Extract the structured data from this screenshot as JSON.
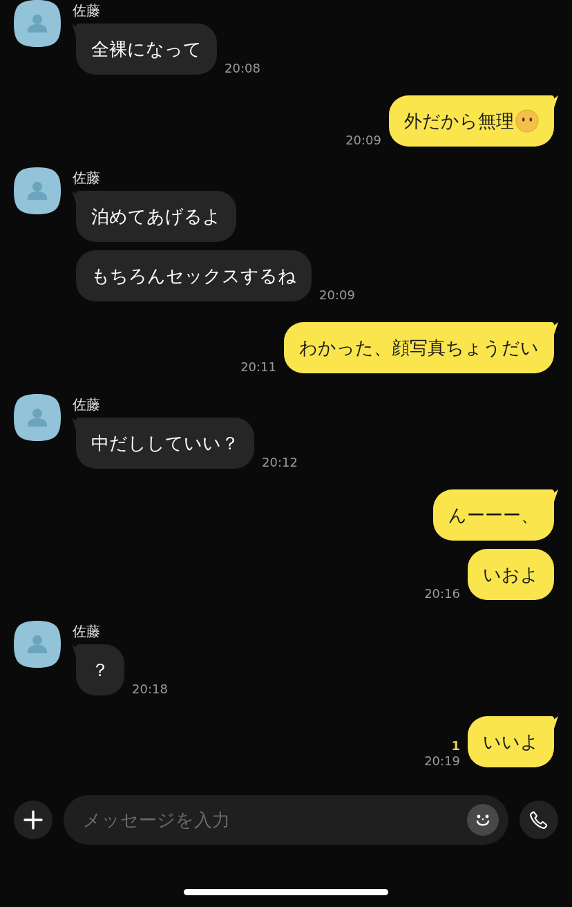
{
  "messages": [
    {
      "kind": "incoming",
      "sender": "佐藤",
      "bubbles": [
        {
          "text": "全裸になって",
          "emoji": false
        }
      ],
      "time": "20:08"
    },
    {
      "kind": "outgoing",
      "bubbles": [
        {
          "text": "外だから無理",
          "emoji": true
        }
      ],
      "time": "20:09"
    },
    {
      "kind": "incoming",
      "sender": "佐藤",
      "bubbles": [
        {
          "text": "泊めてあげるよ",
          "emoji": false
        },
        {
          "text": "もちろんセックスするね",
          "emoji": false
        }
      ],
      "time": "20:09"
    },
    {
      "kind": "outgoing",
      "bubbles": [
        {
          "text": "わかった、顔写真ちょうだい",
          "emoji": false
        }
      ],
      "time": "20:11"
    },
    {
      "kind": "incoming",
      "sender": "佐藤",
      "bubbles": [
        {
          "text": "中だししていい？",
          "emoji": false
        }
      ],
      "time": "20:12"
    },
    {
      "kind": "outgoing",
      "bubbles": [
        {
          "text": "んーーー、",
          "emoji": false
        },
        {
          "text": "いおよ",
          "emoji": false
        }
      ],
      "time": "20:16"
    },
    {
      "kind": "incoming",
      "sender": "佐藤",
      "bubbles": [
        {
          "text": "？",
          "emoji": false
        }
      ],
      "time": "20:18"
    },
    {
      "kind": "outgoing",
      "bubbles": [
        {
          "text": "いいよ",
          "emoji": false
        }
      ],
      "time": "20:19",
      "read": "1"
    }
  ],
  "composer": {
    "placeholder": "メッセージを入力"
  }
}
